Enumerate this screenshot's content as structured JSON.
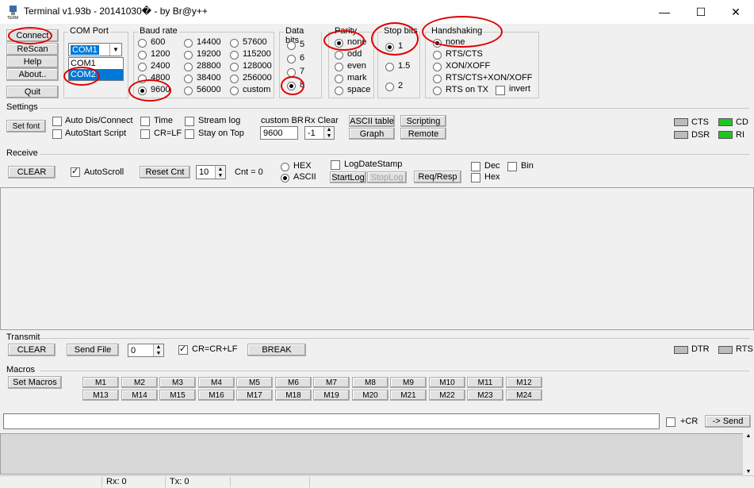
{
  "window": {
    "title": "Terminal v1.93b - 20141030� - by Br@y++",
    "minimize": "—",
    "maximize": "☐",
    "close": "✕"
  },
  "left_buttons": {
    "connect": "Connect",
    "rescan": "ReScan",
    "help": "Help",
    "about": "About..",
    "quit": "Quit"
  },
  "com_port": {
    "label": "COM Port",
    "selected": "COM1",
    "options": [
      "COM1",
      "COM2"
    ],
    "highlighted": "COM2"
  },
  "baud_rate": {
    "label": "Baud rate",
    "col1": [
      "600",
      "1200",
      "2400",
      "4800",
      "9600"
    ],
    "col2": [
      "14400",
      "19200",
      "28800",
      "38400",
      "56000"
    ],
    "col3": [
      "57600",
      "115200",
      "128000",
      "256000",
      "custom"
    ],
    "selected": "9600"
  },
  "data_bits": {
    "label": "Data bits",
    "options": [
      "5",
      "6",
      "7",
      "8"
    ],
    "selected": "8"
  },
  "parity": {
    "label": "Parity",
    "options": [
      "none",
      "odd",
      "even",
      "mark",
      "space"
    ],
    "selected": "none"
  },
  "stop_bits": {
    "label": "Stop bits",
    "options": [
      "1",
      "1.5",
      "2"
    ],
    "selected": "1"
  },
  "handshaking": {
    "label": "Handshaking",
    "options": [
      "none",
      "RTS/CTS",
      "XON/XOFF",
      "RTS/CTS+XON/XOFF",
      "RTS on TX"
    ],
    "invert": "invert",
    "selected": "none"
  },
  "settings": {
    "label": "Settings",
    "set_font": "Set font",
    "auto_dis_connect": "Auto Dis/Connect",
    "autostart_script": "AutoStart Script",
    "time": "Time",
    "cr_lf": "CR=LF",
    "stream_log": "Stream log",
    "stay_on_top": "Stay on Top",
    "custom_br_label": "custom BR",
    "custom_br_value": "9600",
    "rx_clear_label": "Rx Clear",
    "rx_clear_value": "-1",
    "ascii_table": "ASCII table",
    "graph": "Graph",
    "scripting": "Scripting",
    "remote": "Remote"
  },
  "signals": {
    "cts": "CTS",
    "cd": "CD",
    "dsr": "DSR",
    "ri": "RI",
    "dtr": "DTR",
    "rts": "RTS"
  },
  "receive": {
    "label": "Receive",
    "clear": "CLEAR",
    "autoscroll": "AutoScroll",
    "reset_cnt": "Reset Cnt",
    "cnt_spin": "10",
    "cnt_text": "Cnt =  0",
    "hex": "HEX",
    "ascii": "ASCII",
    "log_date_stamp": "LogDateStamp",
    "start_log": "StartLog",
    "stop_log": "StopLog",
    "req_resp": "Req/Resp",
    "dec": "Dec",
    "hex_cb": "Hex",
    "bin": "Bin"
  },
  "transmit": {
    "label": "Transmit",
    "clear": "CLEAR",
    "send_file": "Send File",
    "spin": "0",
    "cr_crlf": "CR=CR+LF",
    "break": "BREAK"
  },
  "macros": {
    "label": "Macros",
    "set_macros": "Set Macros",
    "row1": [
      "M1",
      "M2",
      "M3",
      "M4",
      "M5",
      "M6",
      "M7",
      "M8",
      "M9",
      "M10",
      "M11",
      "M12"
    ],
    "row2": [
      "M13",
      "M14",
      "M15",
      "M16",
      "M17",
      "M18",
      "M19",
      "M20",
      "M21",
      "M22",
      "M23",
      "M24"
    ]
  },
  "send_bar": {
    "plus_cr": "+CR",
    "send": "-> Send"
  },
  "status": {
    "rx": "Rx: 0",
    "tx": "Tx: 0"
  }
}
